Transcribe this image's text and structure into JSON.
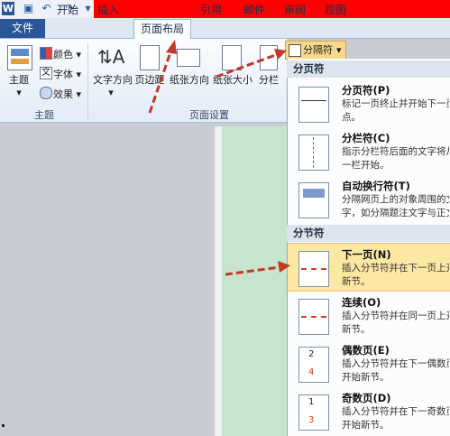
{
  "window": {
    "logo": "W",
    "quick_access": [
      "save-icon",
      "undo-icon",
      "redo-icon",
      "customize-icon"
    ]
  },
  "tabs": {
    "file": "文件",
    "home": "开始",
    "insert": "插入",
    "page_layout": "页面布局",
    "references": "引用",
    "mailings": "邮件",
    "review": "审阅",
    "view": "视图"
  },
  "ribbon": {
    "theme_group": {
      "themes": "主题",
      "colors": "颜色",
      "fonts": "字体",
      "effects": "效果",
      "label": "主题"
    },
    "page_setup": {
      "text_direction": "文字方向",
      "margins": "页边距",
      "orientation": "纸张方向",
      "size": "纸张大小",
      "columns": "分栏",
      "label": "页面设置"
    },
    "breaks_button": "分隔符"
  },
  "dropdown": {
    "page_breaks_header": "分页符",
    "section_breaks_header": "分节符",
    "items": [
      {
        "title": "分页符(P)",
        "desc1": "标记一页终止并开始下一页",
        "desc2": "点。"
      },
      {
        "title": "分栏符(C)",
        "desc1": "指示分栏符后面的文字将从",
        "desc2": "一栏开始。"
      },
      {
        "title": "自动换行符(T)",
        "desc1": "分隔网页上的对象周围的文",
        "desc2": "字，如分隔题注文字与正文"
      },
      {
        "title": "下一页(N)",
        "desc1": "插入分节符并在下一页上开",
        "desc2": "新节。"
      },
      {
        "title": "连续(O)",
        "desc1": "插入分节符并在同一页上开",
        "desc2": "新节。"
      },
      {
        "title": "偶数页(E)",
        "desc1": "插入分节符并在下一偶数页",
        "desc2": "开始新节。"
      },
      {
        "title": "奇数页(D)",
        "desc1": "插入分节符并在下一奇数页",
        "desc2": "开始新节。"
      }
    ],
    "icon_numbers": {
      "even_top": "2",
      "even_bottom": "4",
      "odd_top": "1",
      "odd_bottom": "3"
    }
  },
  "colors": {
    "accent": "#2a5699",
    "highlight": "#fce7a3",
    "annotation_arrow": "#c0392b",
    "title_red": "#ff0000"
  }
}
